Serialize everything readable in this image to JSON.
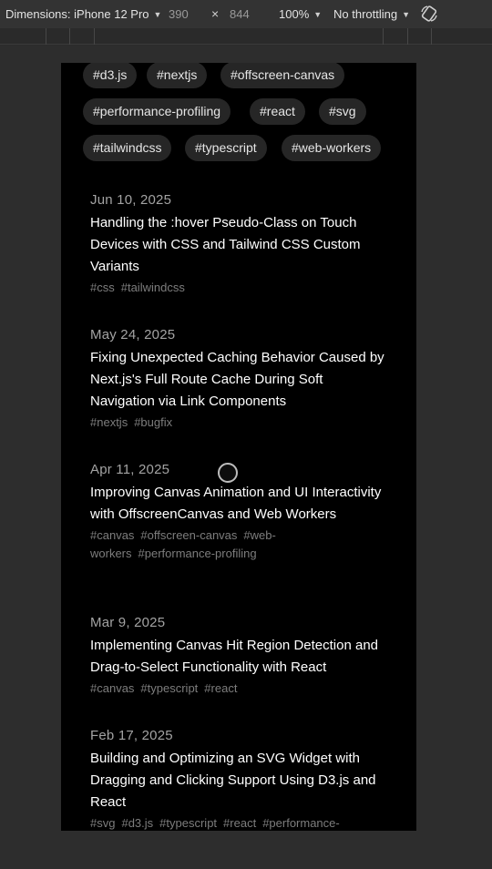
{
  "devtools": {
    "dimensions_label": "Dimensions: iPhone 12 Pro",
    "width": "390",
    "times": "×",
    "height": "844",
    "zoom": "100%",
    "throttling": "No throttling"
  },
  "tags": [
    "#d3.js",
    "#nextjs",
    "#offscreen-canvas",
    "#performance-profiling",
    "#react",
    "#svg",
    "#tailwindcss",
    "#typescript",
    "#web-workers"
  ],
  "posts": [
    {
      "date": "Jun 10, 2025",
      "title": "Handling the :hover Pseudo-Class on Touch Devices with CSS and Tailwind CSS Custom Variants",
      "tags": [
        "#css",
        "#tailwindcss"
      ]
    },
    {
      "date": "May 24, 2025",
      "title": "Fixing Unexpected Caching Behavior Caused by Next.js's Full Route Cache During Soft Navigation via Link Components",
      "tags": [
        "#nextjs",
        "#bugfix"
      ]
    },
    {
      "date": "Apr 11, 2025",
      "title": "Improving Canvas Animation and UI Interactivity with OffscreenCanvas and Web Workers",
      "tags": [
        "#canvas",
        "#offscreen-canvas",
        "#web-workers",
        "#performance-profiling"
      ]
    },
    {
      "date": "Mar 9, 2025",
      "title": "Implementing Canvas Hit Region Detection and Drag-to-Select Functionality with React",
      "tags": [
        "#canvas",
        "#typescript",
        "#react"
      ]
    },
    {
      "date": "Feb 17, 2025",
      "title": "Building and Optimizing an SVG Widget with Dragging and Clicking Support Using D3.js and React",
      "tags": [
        "#svg",
        "#d3.js",
        "#typescript",
        "#react",
        "#performance-"
      ]
    }
  ]
}
